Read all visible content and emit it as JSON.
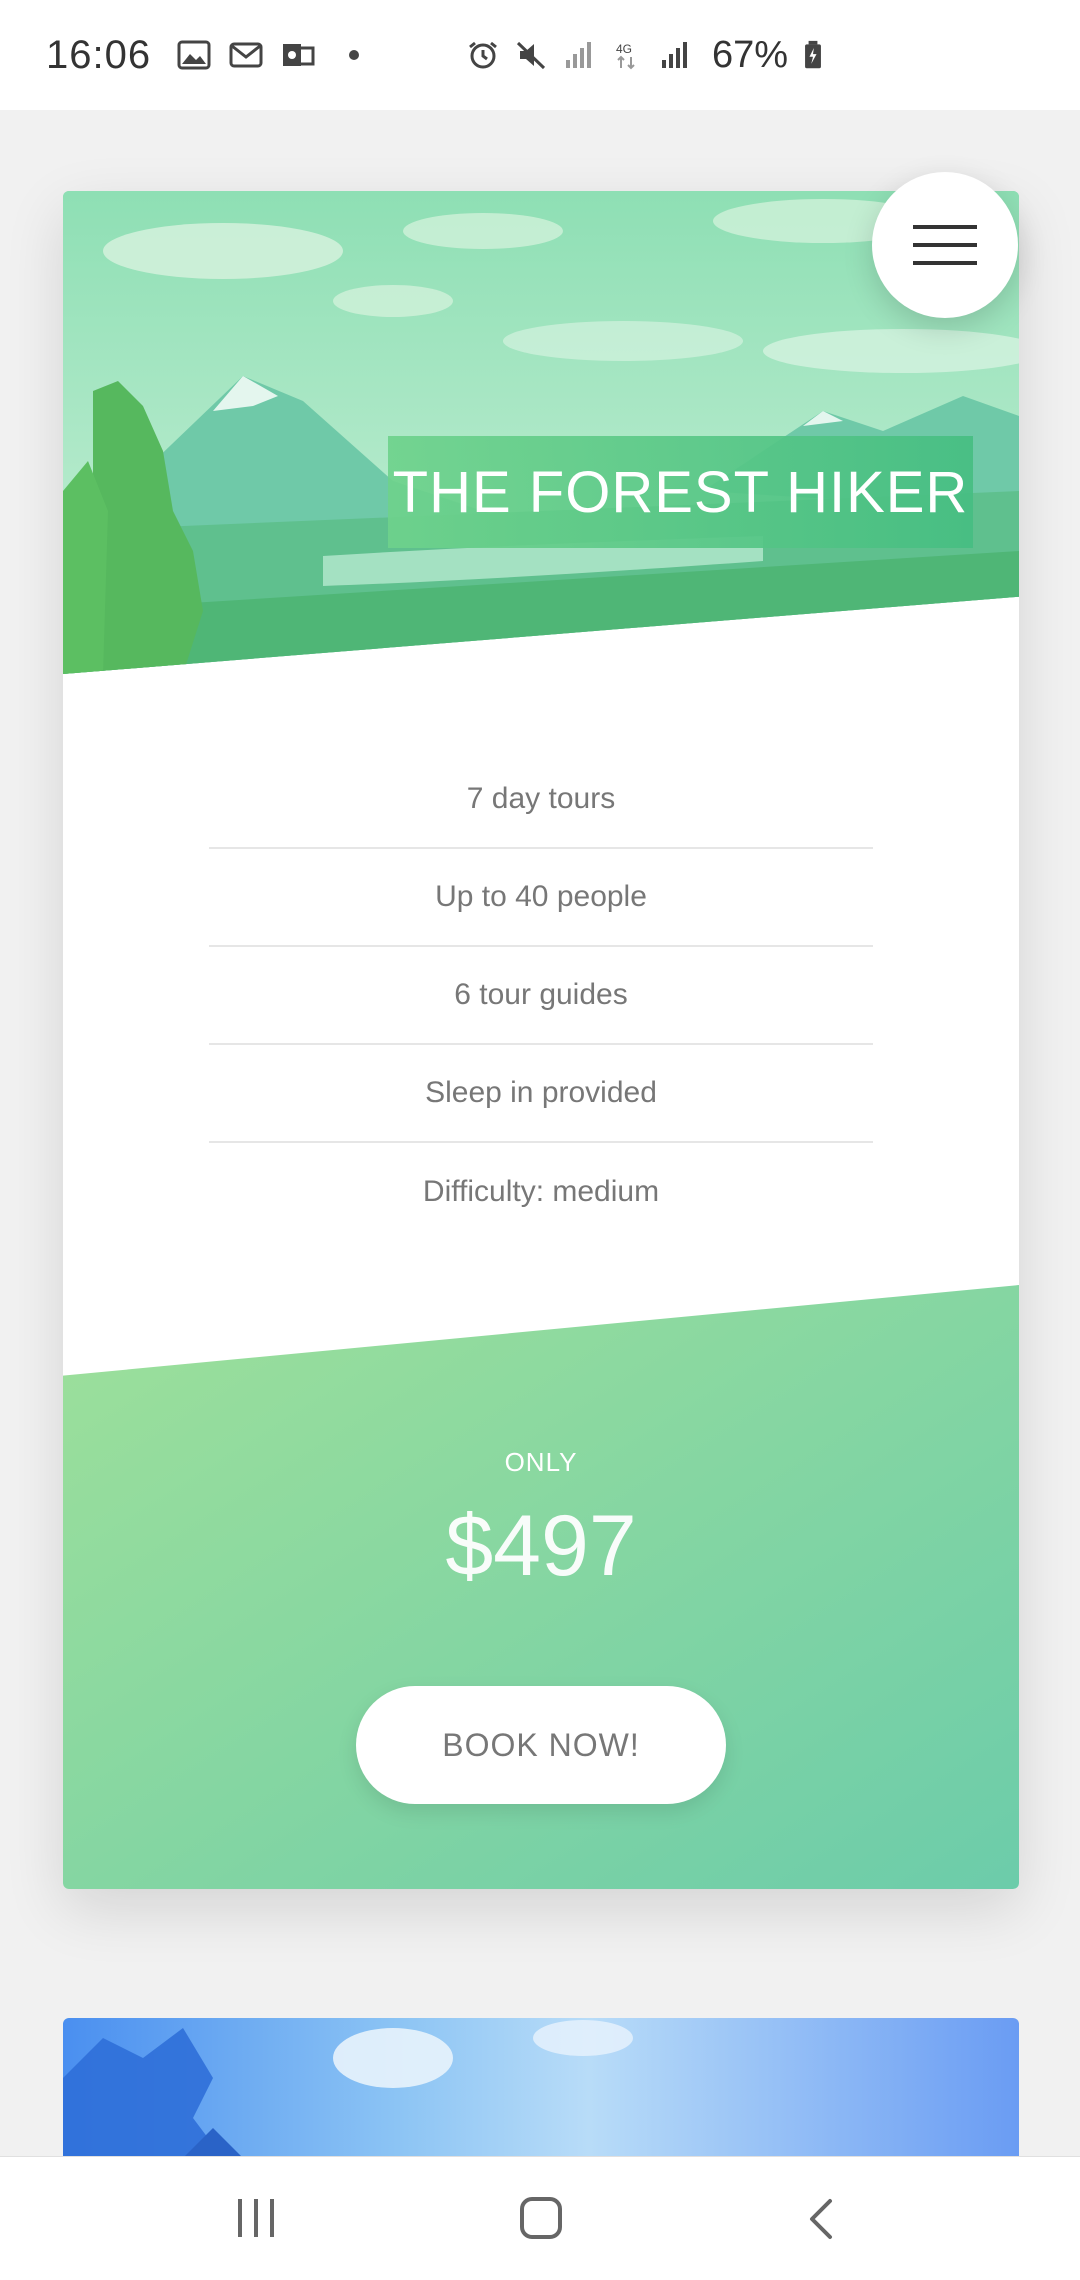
{
  "status_bar": {
    "time": "16:06",
    "battery_percent": "67%",
    "network": "4G",
    "left_icons": [
      "gallery-icon",
      "gmail-icon",
      "outlook-icon",
      "dot-icon"
    ],
    "right_icons": [
      "alarm-icon",
      "mute-icon",
      "signal-icon",
      "4g-icon",
      "signal-icon",
      "battery-charging-icon"
    ]
  },
  "tour_card": {
    "title": "THE FOREST HIKER",
    "features": [
      "7 day tours",
      "Up to 40 people",
      "6 tour guides",
      "Sleep in provided",
      "Difficulty: medium"
    ],
    "price_label": "ONLY",
    "price": "$497",
    "book_button": "BOOK NOW!"
  },
  "colors": {
    "accent_green_light": "#9ee09a",
    "accent_green_dark": "#6cccaa",
    "text_gray": "#777777",
    "page_bg": "#f1f1f1"
  },
  "nav_bar": {
    "icons": [
      "recent-apps-icon",
      "home-icon",
      "back-icon"
    ]
  }
}
